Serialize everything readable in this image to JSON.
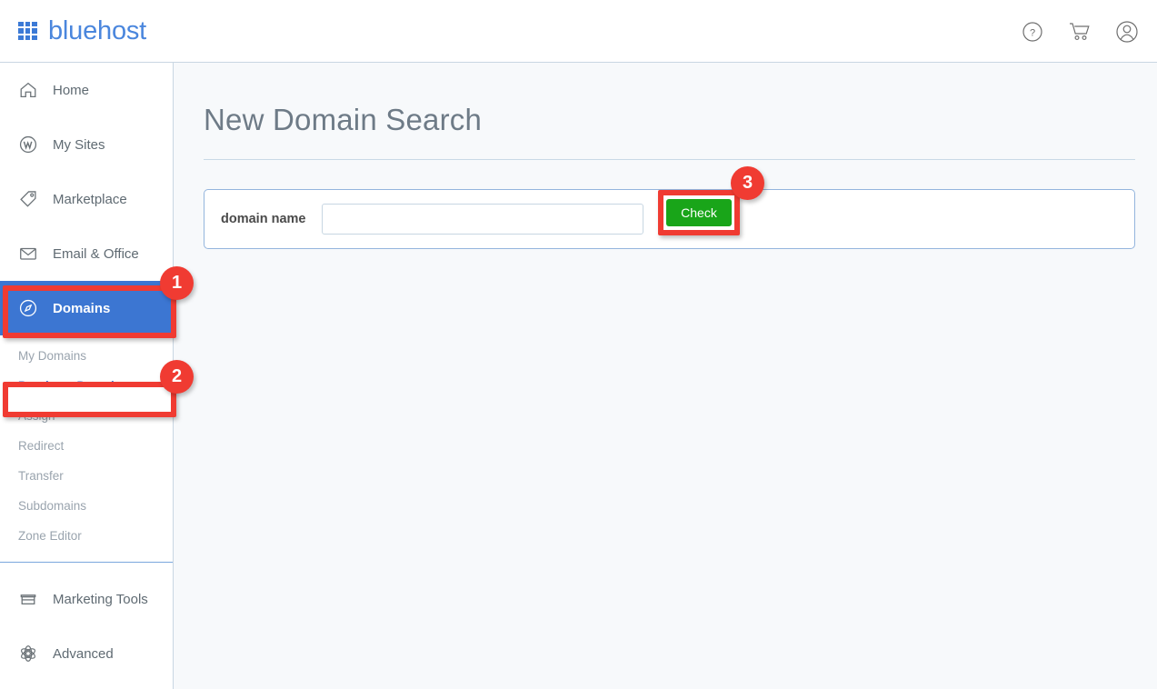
{
  "header": {
    "brand_name": "bluehost",
    "logo_icon": "grid-logo-icon",
    "icons": [
      {
        "name": "help-icon",
        "label": "?"
      },
      {
        "name": "cart-icon",
        "label": ""
      },
      {
        "name": "account-icon",
        "label": ""
      }
    ]
  },
  "sidebar": {
    "items": [
      {
        "label": "Home",
        "icon": "home-icon",
        "active": false
      },
      {
        "label": "My Sites",
        "icon": "wordpress-icon",
        "active": false
      },
      {
        "label": "Marketplace",
        "icon": "tag-icon",
        "active": false
      },
      {
        "label": "Email & Office",
        "icon": "envelope-icon",
        "active": false
      },
      {
        "label": "Domains",
        "icon": "compass-icon",
        "active": true
      }
    ],
    "sub_items": [
      {
        "label": "My Domains",
        "selected": false
      },
      {
        "label": "Purchase Domain",
        "selected": true
      },
      {
        "label": "Assign",
        "selected": false
      },
      {
        "label": "Redirect",
        "selected": false
      },
      {
        "label": "Transfer",
        "selected": false
      },
      {
        "label": "Subdomains",
        "selected": false
      },
      {
        "label": "Zone Editor",
        "selected": false
      }
    ],
    "bottom_items": [
      {
        "label": "Marketing Tools",
        "icon": "store-icon"
      },
      {
        "label": "Advanced",
        "icon": "atom-icon"
      }
    ]
  },
  "main": {
    "page_title": "New Domain Search",
    "form": {
      "field_label": "domain name",
      "input_value": "",
      "input_placeholder": "",
      "check_label": "Check"
    }
  },
  "annotations": {
    "badges": [
      "1",
      "2",
      "3"
    ],
    "accent_color": "#f03b32",
    "active_nav_color": "#3c76d2",
    "button_color": "#19a519",
    "brand_color": "#4a86dd"
  }
}
